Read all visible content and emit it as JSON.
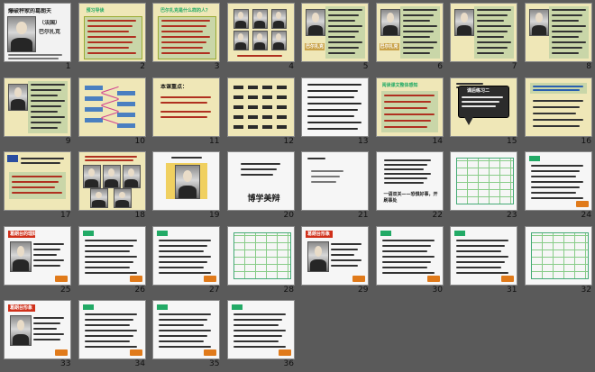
{
  "slides": [
    {
      "num": "1",
      "kind": "cover",
      "title": "爆破秤家的葛朗天",
      "subtitle": "（法国）",
      "author": "巴尔扎克"
    },
    {
      "num": "2",
      "kind": "yellow",
      "title": "预习导读"
    },
    {
      "num": "3",
      "kind": "yellow",
      "title": "巴尔扎克是什么样的人？"
    },
    {
      "num": "4",
      "kind": "portraits"
    },
    {
      "num": "5",
      "kind": "lined-portrait",
      "label": "巴尔扎克"
    },
    {
      "num": "6",
      "kind": "lined-portrait",
      "label": "巴尔扎克"
    },
    {
      "num": "7",
      "kind": "lined-portrait",
      "label": ""
    },
    {
      "num": "8",
      "kind": "lined-portrait",
      "label": ""
    },
    {
      "num": "9",
      "kind": "lined-portrait",
      "label": ""
    },
    {
      "num": "10",
      "kind": "mindmap"
    },
    {
      "num": "11",
      "kind": "goals",
      "title": "本课重点："
    },
    {
      "num": "12",
      "kind": "vocab"
    },
    {
      "num": "13",
      "kind": "vocab2"
    },
    {
      "num": "14",
      "kind": "reading",
      "title": "阅读课文整体感知"
    },
    {
      "num": "15",
      "kind": "callout",
      "title": "课后练习二"
    },
    {
      "num": "16",
      "kind": "qa"
    },
    {
      "num": "17",
      "kind": "qa2"
    },
    {
      "num": "18",
      "kind": "sketches"
    },
    {
      "num": "19",
      "kind": "portrait-center"
    },
    {
      "num": "20",
      "kind": "text",
      "big": "博学美辩"
    },
    {
      "num": "21",
      "kind": "text-small"
    },
    {
      "num": "22",
      "kind": "text-line",
      "big": "一语双关——恐惧好事，开刷事处"
    },
    {
      "num": "23",
      "kind": "table"
    },
    {
      "num": "24",
      "kind": "list"
    },
    {
      "num": "25",
      "kind": "portrait-left",
      "label": "葛朗台的理财"
    },
    {
      "num": "26",
      "kind": "list"
    },
    {
      "num": "27",
      "kind": "list"
    },
    {
      "num": "28",
      "kind": "table"
    },
    {
      "num": "29",
      "kind": "portrait-left",
      "label": "葛朗台形象"
    },
    {
      "num": "30",
      "kind": "list"
    },
    {
      "num": "31",
      "kind": "list"
    },
    {
      "num": "32",
      "kind": "table"
    },
    {
      "num": "33",
      "kind": "portrait-left",
      "label": "葛朗台形象"
    },
    {
      "num": "34",
      "kind": "list"
    },
    {
      "num": "35",
      "kind": "list"
    },
    {
      "num": "36",
      "kind": "list"
    }
  ]
}
